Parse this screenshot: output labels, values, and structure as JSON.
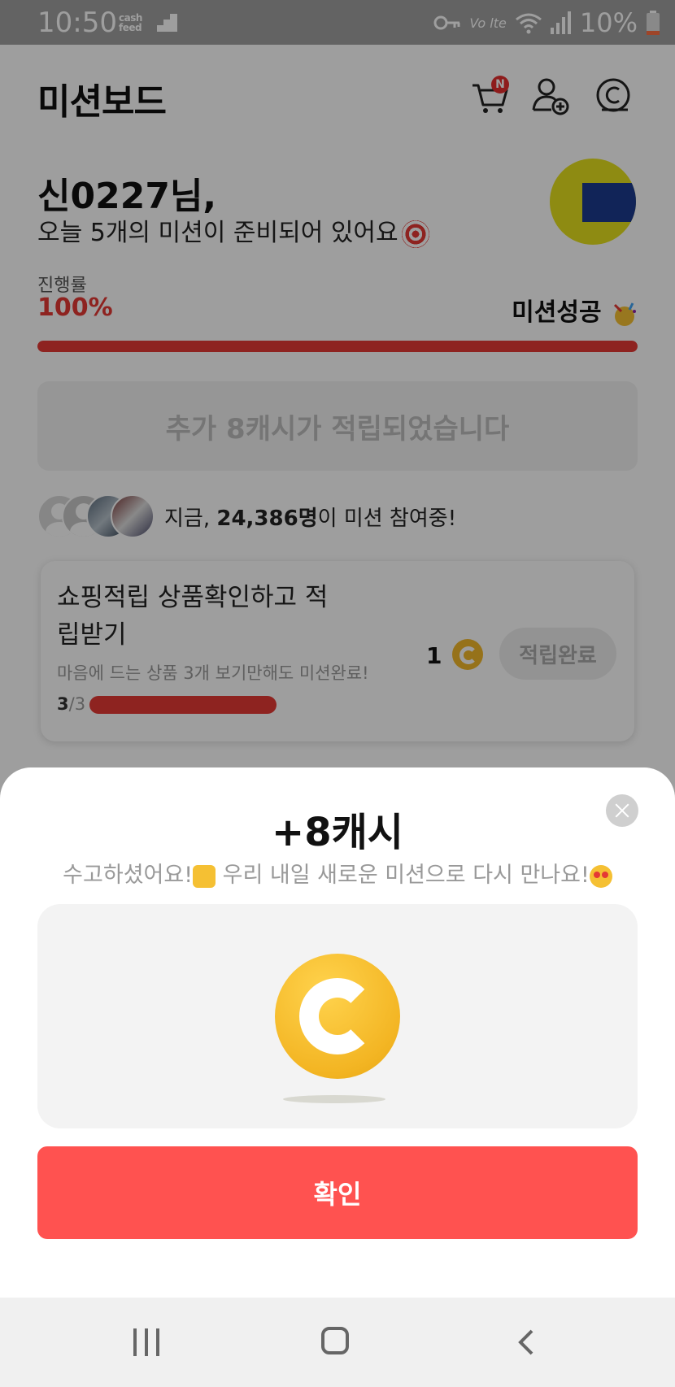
{
  "status_bar": {
    "time": "10:50",
    "app_icon_text": "cash feed",
    "network": "Vo lte",
    "battery": "10%"
  },
  "header": {
    "title": "미션보드",
    "cart_badge": "N",
    "icons": [
      "cart-icon",
      "add-friend-icon",
      "cash-coin-icon"
    ]
  },
  "greeting": {
    "name_line": "신0227님,",
    "message": "오늘 5개의 미션이 준비되어 있어요"
  },
  "progress": {
    "label": "진행률",
    "value_text": "100%",
    "fraction": 1.0,
    "success_text": "미션성공"
  },
  "cash_notice": "추가 8캐시가 적립되었습니다",
  "participants": {
    "prefix": "지금, ",
    "count": "24,386명",
    "suffix": "이 미션 참여중!"
  },
  "mission": {
    "title": "쇼핑적립 상품확인하고 적립받기",
    "description": "마음에 드는 상품 3개 보기만해도 미션완료!",
    "done": "3",
    "total": "/3",
    "progress_fraction": 1.0,
    "reward": "1",
    "button_label": "적립완료"
  },
  "sheet": {
    "title": "+8캐시",
    "message_part1": "수고하셨어요!",
    "message_part2": " 우리 내일 새로운 미션으로 다시 만나요!",
    "confirm_label": "확인"
  },
  "colors": {
    "accent_red": "#e53935",
    "confirm_button": "#ff5250",
    "coin_gold": "#f3b523"
  }
}
